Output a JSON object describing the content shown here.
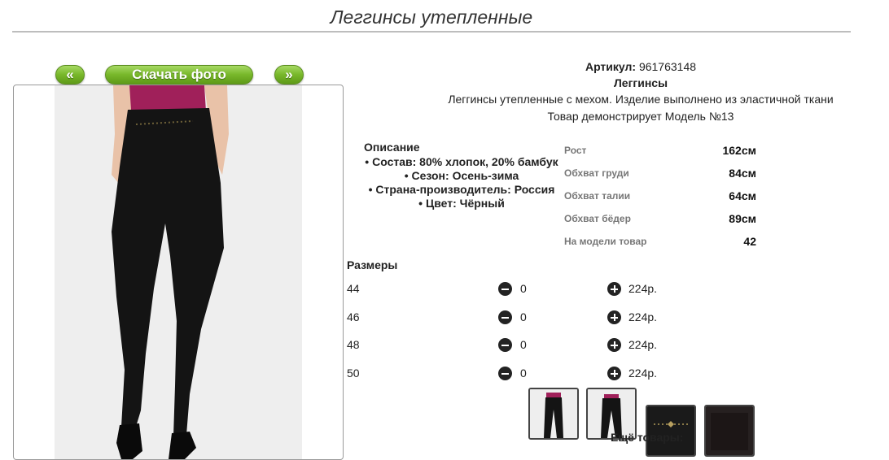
{
  "page": {
    "title": "Леггинсы утепленные"
  },
  "gallery": {
    "prev_label": "«",
    "download_label": "Скачать фото",
    "next_label": "»"
  },
  "product": {
    "article_label": "Артикул:",
    "article_value": "961763148",
    "category": "Леггинсы",
    "description": "Леггинсы утепленные с мехом. Изделие выполнено из эластичной ткани",
    "model_note": "Товар демонстрирует Модель №13"
  },
  "details": {
    "header": "Описание",
    "items": [
      "Состав: 80% хлопок, 20% бамбук",
      "Сезон: Осень-зима",
      "Страна-производитель: Россия",
      "Цвет: Чёрный"
    ]
  },
  "measurements": [
    {
      "label": "Рост",
      "value": "162см"
    },
    {
      "label": "Обхват груди",
      "value": "84см"
    },
    {
      "label": "Обхват талии",
      "value": "64см"
    },
    {
      "label": "Обхват бёдер",
      "value": "89см"
    },
    {
      "label": "На модели товар",
      "value": "42"
    }
  ],
  "sizes": {
    "header": "Размеры",
    "rows": [
      {
        "size": "44",
        "qty": "0",
        "price": "224р."
      },
      {
        "size": "46",
        "qty": "0",
        "price": "224р."
      },
      {
        "size": "48",
        "qty": "0",
        "price": "224р."
      },
      {
        "size": "50",
        "qty": "0",
        "price": "224р."
      }
    ]
  },
  "more_products": {
    "header": "Ещё товары:"
  },
  "colors": {
    "accent_green": "#78b72a",
    "legging_black": "#141414",
    "top_magenta": "#a0205a"
  }
}
